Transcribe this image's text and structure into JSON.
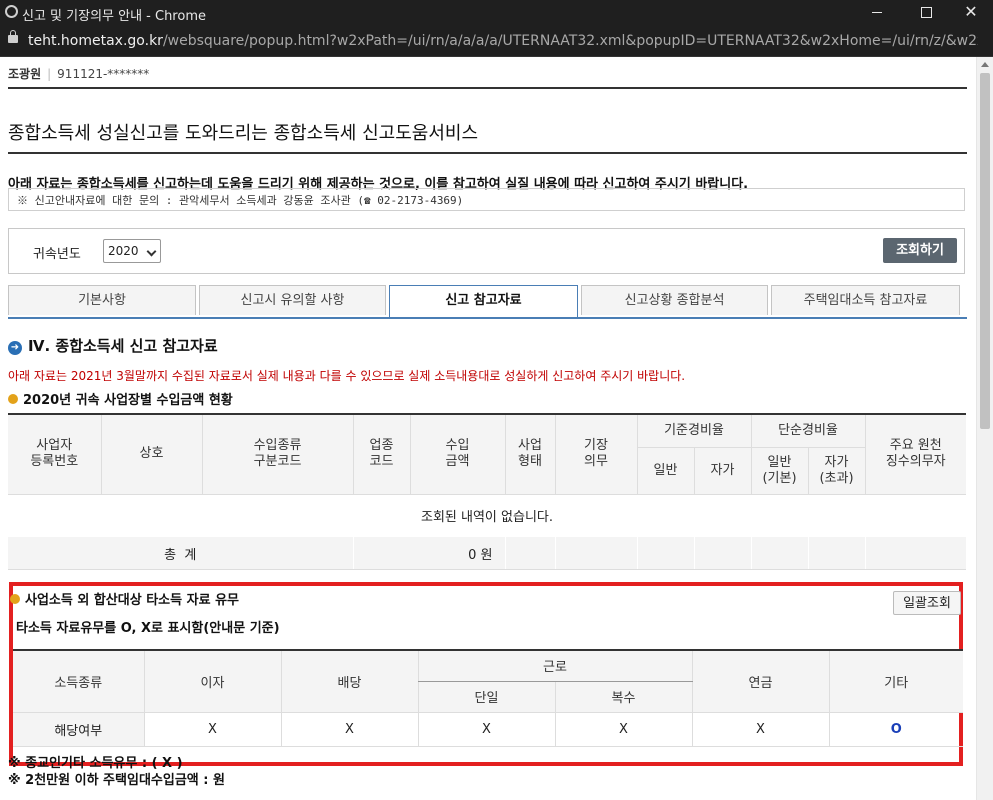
{
  "window": {
    "title": "신고 및 기장의무 안내 - Chrome",
    "url_host": "teht.hometax.go.kr",
    "url_path": "/websquare/popup.html?w2xPath=/ui/rn/a/a/a/a/UTERNAAT32.xml&popupID=UTERNAAT32&w2xHome=/ui/rn/z/&w2xDocume..."
  },
  "user": {
    "name": "조광원",
    "rrn": "911121-*******"
  },
  "page": {
    "title": "종합소득세 성실신고를 도와드리는 종합소득세 신고도움서비스",
    "notice": "아래 자료는 종합소득세를 신고하는데 도움을 드리기 위해 제공하는 것으로, 이를 참고하여 실질 내용에 따라 신고하여 주시기 바랍니다.",
    "contact": "※ 신고안내자료에 대한 문의 : 관악세무서 소득세과 강동윤 조사관 (☎ 02-2173-4369)"
  },
  "filter": {
    "year_label": "귀속년도",
    "year_value": "2020",
    "query_button": "조회하기"
  },
  "tabs": [
    "기본사항",
    "신고시 유의할 사항",
    "신고 참고자료",
    "신고상황 종합분석",
    "주택임대소득 참고자료"
  ],
  "active_tab": 2,
  "section": {
    "title": "Ⅳ. 종합소득세 신고 참고자료",
    "warning": "아래 자료는 2021년 3월말까지 수집된 자료로서 실제 내용과 다를 수 있으므로 실제 소득내용대로 성실하게 신고하여 주시기 바랍니다.",
    "sub_title": "2020년 귀속 사업장별 수입금액 현황"
  },
  "biz_table": {
    "headers": {
      "reg_no": "사업자\n등록번호",
      "trade_name": "상호",
      "income_type": "수입종류\n구분코드",
      "industry": "업종\n코드",
      "revenue": "수입\n금액",
      "biz_form": "사업\n형태",
      "bookkeeping": "기장\n의무",
      "std_rate": "기준경비율",
      "std_general": "일반",
      "std_self": "자가",
      "simple_rate": "단순경비율",
      "simple_general": "일반\n(기본)",
      "simple_self": "자가\n(초과)",
      "withholder": "주요 원천\n징수의무자"
    },
    "empty_message": "조회된 내역이 없습니다.",
    "total_label": "총  계",
    "total_amount": "0 원"
  },
  "other_income": {
    "title": "사업소득 외 합산대상 타소득 자료 유무",
    "bulk_button": "일괄조회",
    "subtitle": "타소득 자료유무를 O, X로 표시함(안내문 기준)",
    "headers": {
      "type": "소득종류",
      "interest": "이자",
      "dividend": "배당",
      "labor": "근로",
      "labor_single": "단일",
      "labor_multi": "복수",
      "pension": "연금",
      "other": "기타"
    },
    "row_label": "해당여부",
    "values": {
      "interest": "X",
      "dividend": "X",
      "labor_single": "X",
      "labor_multi": "X",
      "pension": "X",
      "other": "O"
    },
    "religion_line": "※ 종교인기타 소득유무 : ( X )",
    "rent_line": "※ 2천만원 이하 주택임대수입금액 : 원"
  }
}
